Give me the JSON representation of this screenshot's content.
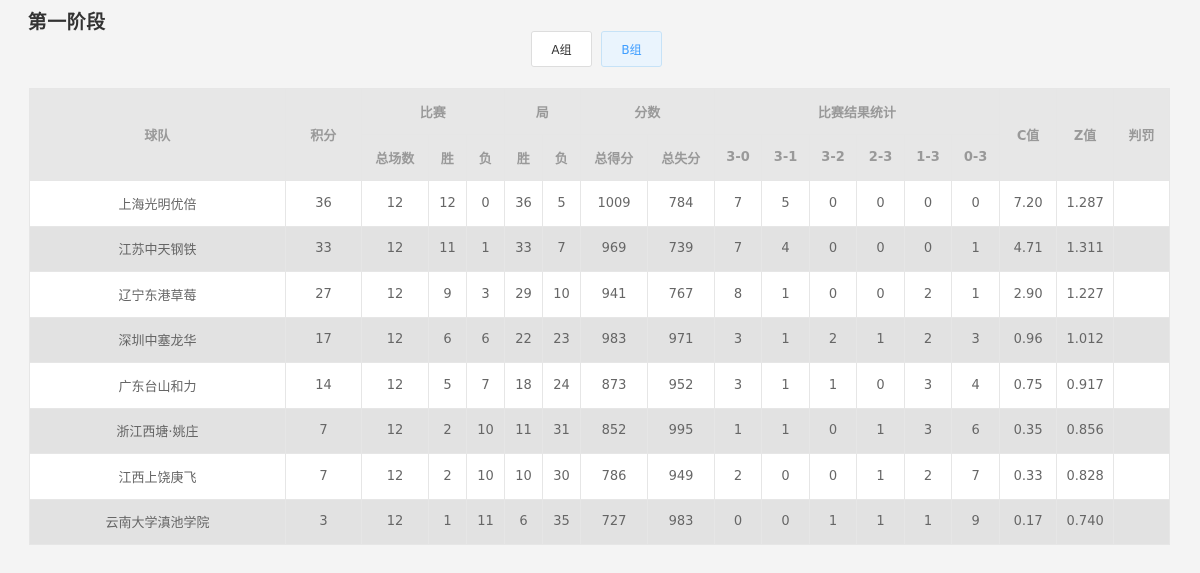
{
  "page": {
    "title": "第一阶段"
  },
  "tabs": [
    {
      "label": "A组",
      "active": false
    },
    {
      "label": "B组",
      "active": true
    }
  ],
  "table": {
    "headers": {
      "team": "球队",
      "points": "积分",
      "matches": "比赛",
      "sets": "局",
      "scores": "分数",
      "results": "比赛结果统计",
      "c": "C值",
      "z": "Z值",
      "penalty": "判罚",
      "total_matches": "总场数",
      "win": "胜",
      "loss": "负",
      "score_for": "总得分",
      "score_against": "总失分",
      "r30": "3-0",
      "r31": "3-1",
      "r32": "3-2",
      "r23": "2-3",
      "r13": "1-3",
      "r03": "0-3"
    },
    "rows": [
      [
        "上海光明优倍",
        "36",
        "12",
        "12",
        "0",
        "36",
        "5",
        "1009",
        "784",
        "7",
        "5",
        "0",
        "0",
        "0",
        "0",
        "7.20",
        "1.287",
        ""
      ],
      [
        "江苏中天钢铁",
        "33",
        "12",
        "11",
        "1",
        "33",
        "7",
        "969",
        "739",
        "7",
        "4",
        "0",
        "0",
        "0",
        "1",
        "4.71",
        "1.311",
        ""
      ],
      [
        "辽宁东港草莓",
        "27",
        "12",
        "9",
        "3",
        "29",
        "10",
        "941",
        "767",
        "8",
        "1",
        "0",
        "0",
        "2",
        "1",
        "2.90",
        "1.227",
        ""
      ],
      [
        "深圳中塞龙华",
        "17",
        "12",
        "6",
        "6",
        "22",
        "23",
        "983",
        "971",
        "3",
        "1",
        "2",
        "1",
        "2",
        "3",
        "0.96",
        "1.012",
        ""
      ],
      [
        "广东台山和力",
        "14",
        "12",
        "5",
        "7",
        "18",
        "24",
        "873",
        "952",
        "3",
        "1",
        "1",
        "0",
        "3",
        "4",
        "0.75",
        "0.917",
        ""
      ],
      [
        "浙江西塘·姚庄",
        "7",
        "12",
        "2",
        "10",
        "11",
        "31",
        "852",
        "995",
        "1",
        "1",
        "0",
        "1",
        "3",
        "6",
        "0.35",
        "0.856",
        ""
      ],
      [
        "江西上饶庚飞",
        "7",
        "12",
        "2",
        "10",
        "10",
        "30",
        "786",
        "949",
        "2",
        "0",
        "0",
        "1",
        "2",
        "7",
        "0.33",
        "0.828",
        ""
      ],
      [
        "云南大学滇池学院",
        "3",
        "12",
        "1",
        "11",
        "6",
        "35",
        "727",
        "983",
        "0",
        "0",
        "1",
        "1",
        "1",
        "9",
        "0.17",
        "0.740",
        ""
      ]
    ]
  }
}
